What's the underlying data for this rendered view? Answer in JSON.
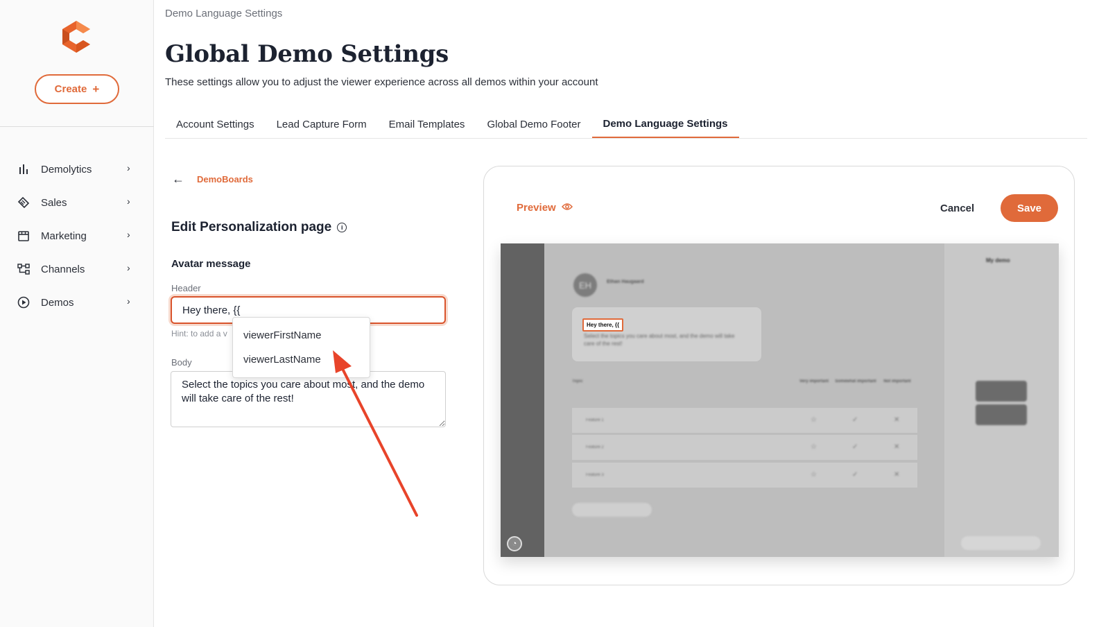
{
  "sidebar": {
    "create_label": "Create",
    "items": [
      {
        "label": "Demolytics",
        "icon": "bar-chart-icon"
      },
      {
        "label": "Sales",
        "icon": "handshake-icon"
      },
      {
        "label": "Marketing",
        "icon": "storefront-icon"
      },
      {
        "label": "Channels",
        "icon": "network-icon"
      },
      {
        "label": "Demos",
        "icon": "play-circle-icon"
      }
    ]
  },
  "header": {
    "breadcrumb": "Demo Language Settings",
    "title": "Global Demo Settings",
    "subtitle": "These settings allow you to adjust the viewer experience across all demos within your account"
  },
  "tabs": [
    {
      "label": "Account Settings",
      "active": false
    },
    {
      "label": "Lead Capture Form",
      "active": false
    },
    {
      "label": "Email Templates",
      "active": false
    },
    {
      "label": "Global Demo Footer",
      "active": false
    },
    {
      "label": "Demo Language Settings",
      "active": true
    }
  ],
  "editor": {
    "back_label": "DemoBoards",
    "section_title": "Edit Personalization page",
    "subsection_title": "Avatar message",
    "header_label": "Header",
    "header_value": "Hey there, {{",
    "hint": "Hint: to add a v",
    "body_label": "Body",
    "body_value": "Select the topics you care about most, and the demo will take care of the rest!",
    "suggestions": [
      "viewerFirstName",
      "viewerLastName"
    ]
  },
  "preview": {
    "label": "Preview",
    "cancel_label": "Cancel",
    "save_label": "Save",
    "demo": {
      "avatar_initials": "EH",
      "author_name": "Ethan Haugaard",
      "bubble_header": "Hey there, {{",
      "bubble_body": "Select the topics you care about most, and the demo will take care of the rest!",
      "topic_header": "Topic",
      "columns": [
        "Very important",
        "Somewhat important",
        "Not important"
      ],
      "rows": [
        "Feature 1",
        "Feature 2",
        "Feature 3"
      ],
      "right_title": "My demo"
    }
  },
  "colors": {
    "accent": "#e06a3a",
    "text_dark": "#1c2230",
    "muted": "#6b6f78"
  }
}
